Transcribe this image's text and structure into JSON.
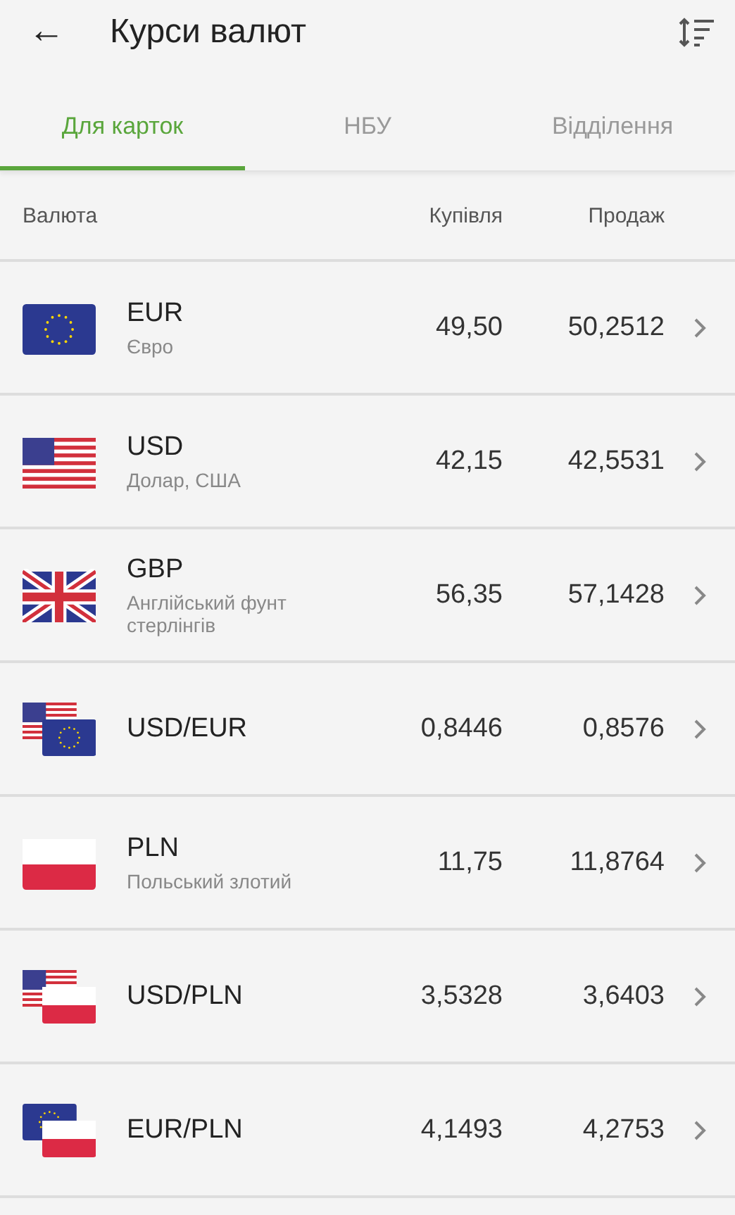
{
  "app_bar": {
    "back_icon": "←",
    "title": "Курси валют"
  },
  "tabs": [
    {
      "label": "Для карток",
      "selected": true
    },
    {
      "label": "НБУ",
      "selected": false
    },
    {
      "label": "Відділення",
      "selected": false
    }
  ],
  "table": {
    "columns": [
      "Валюта",
      "Купівля",
      "Продаж"
    ],
    "rows": [
      {
        "flags": [
          {
            "kind": "eu"
          }
        ],
        "code": "EUR",
        "name": "Євро",
        "buy": "49,50",
        "sell": "50,2512"
      },
      {
        "flags": [
          {
            "kind": "us"
          }
        ],
        "code": "USD",
        "name": "Долар, США",
        "buy": "42,15",
        "sell": "42,5531"
      },
      {
        "flags": [
          {
            "kind": "gb"
          }
        ],
        "code": "GBP",
        "name": "Англійський фунт стерлінгів",
        "buy": "56,35",
        "sell": "57,1428"
      },
      {
        "flags": [
          {
            "kind": "us"
          },
          {
            "kind": "eu"
          }
        ],
        "code": "USD/EUR",
        "buy": "0,8446",
        "sell": "0,8576"
      },
      {
        "flags": [
          {
            "kind": "pl"
          }
        ],
        "code": "PLN",
        "name": "Польський злотий",
        "buy": "11,75",
        "sell": "11,8764"
      },
      {
        "flags": [
          {
            "kind": "us"
          },
          {
            "kind": "pl"
          }
        ],
        "code": "USD/PLN",
        "buy": "3,5328",
        "sell": "3,6403"
      },
      {
        "flags": [
          {
            "kind": "eu"
          },
          {
            "kind": "pl"
          }
        ],
        "code": "EUR/PLN",
        "buy": "4,1493",
        "sell": "4,2753"
      }
    ]
  }
}
